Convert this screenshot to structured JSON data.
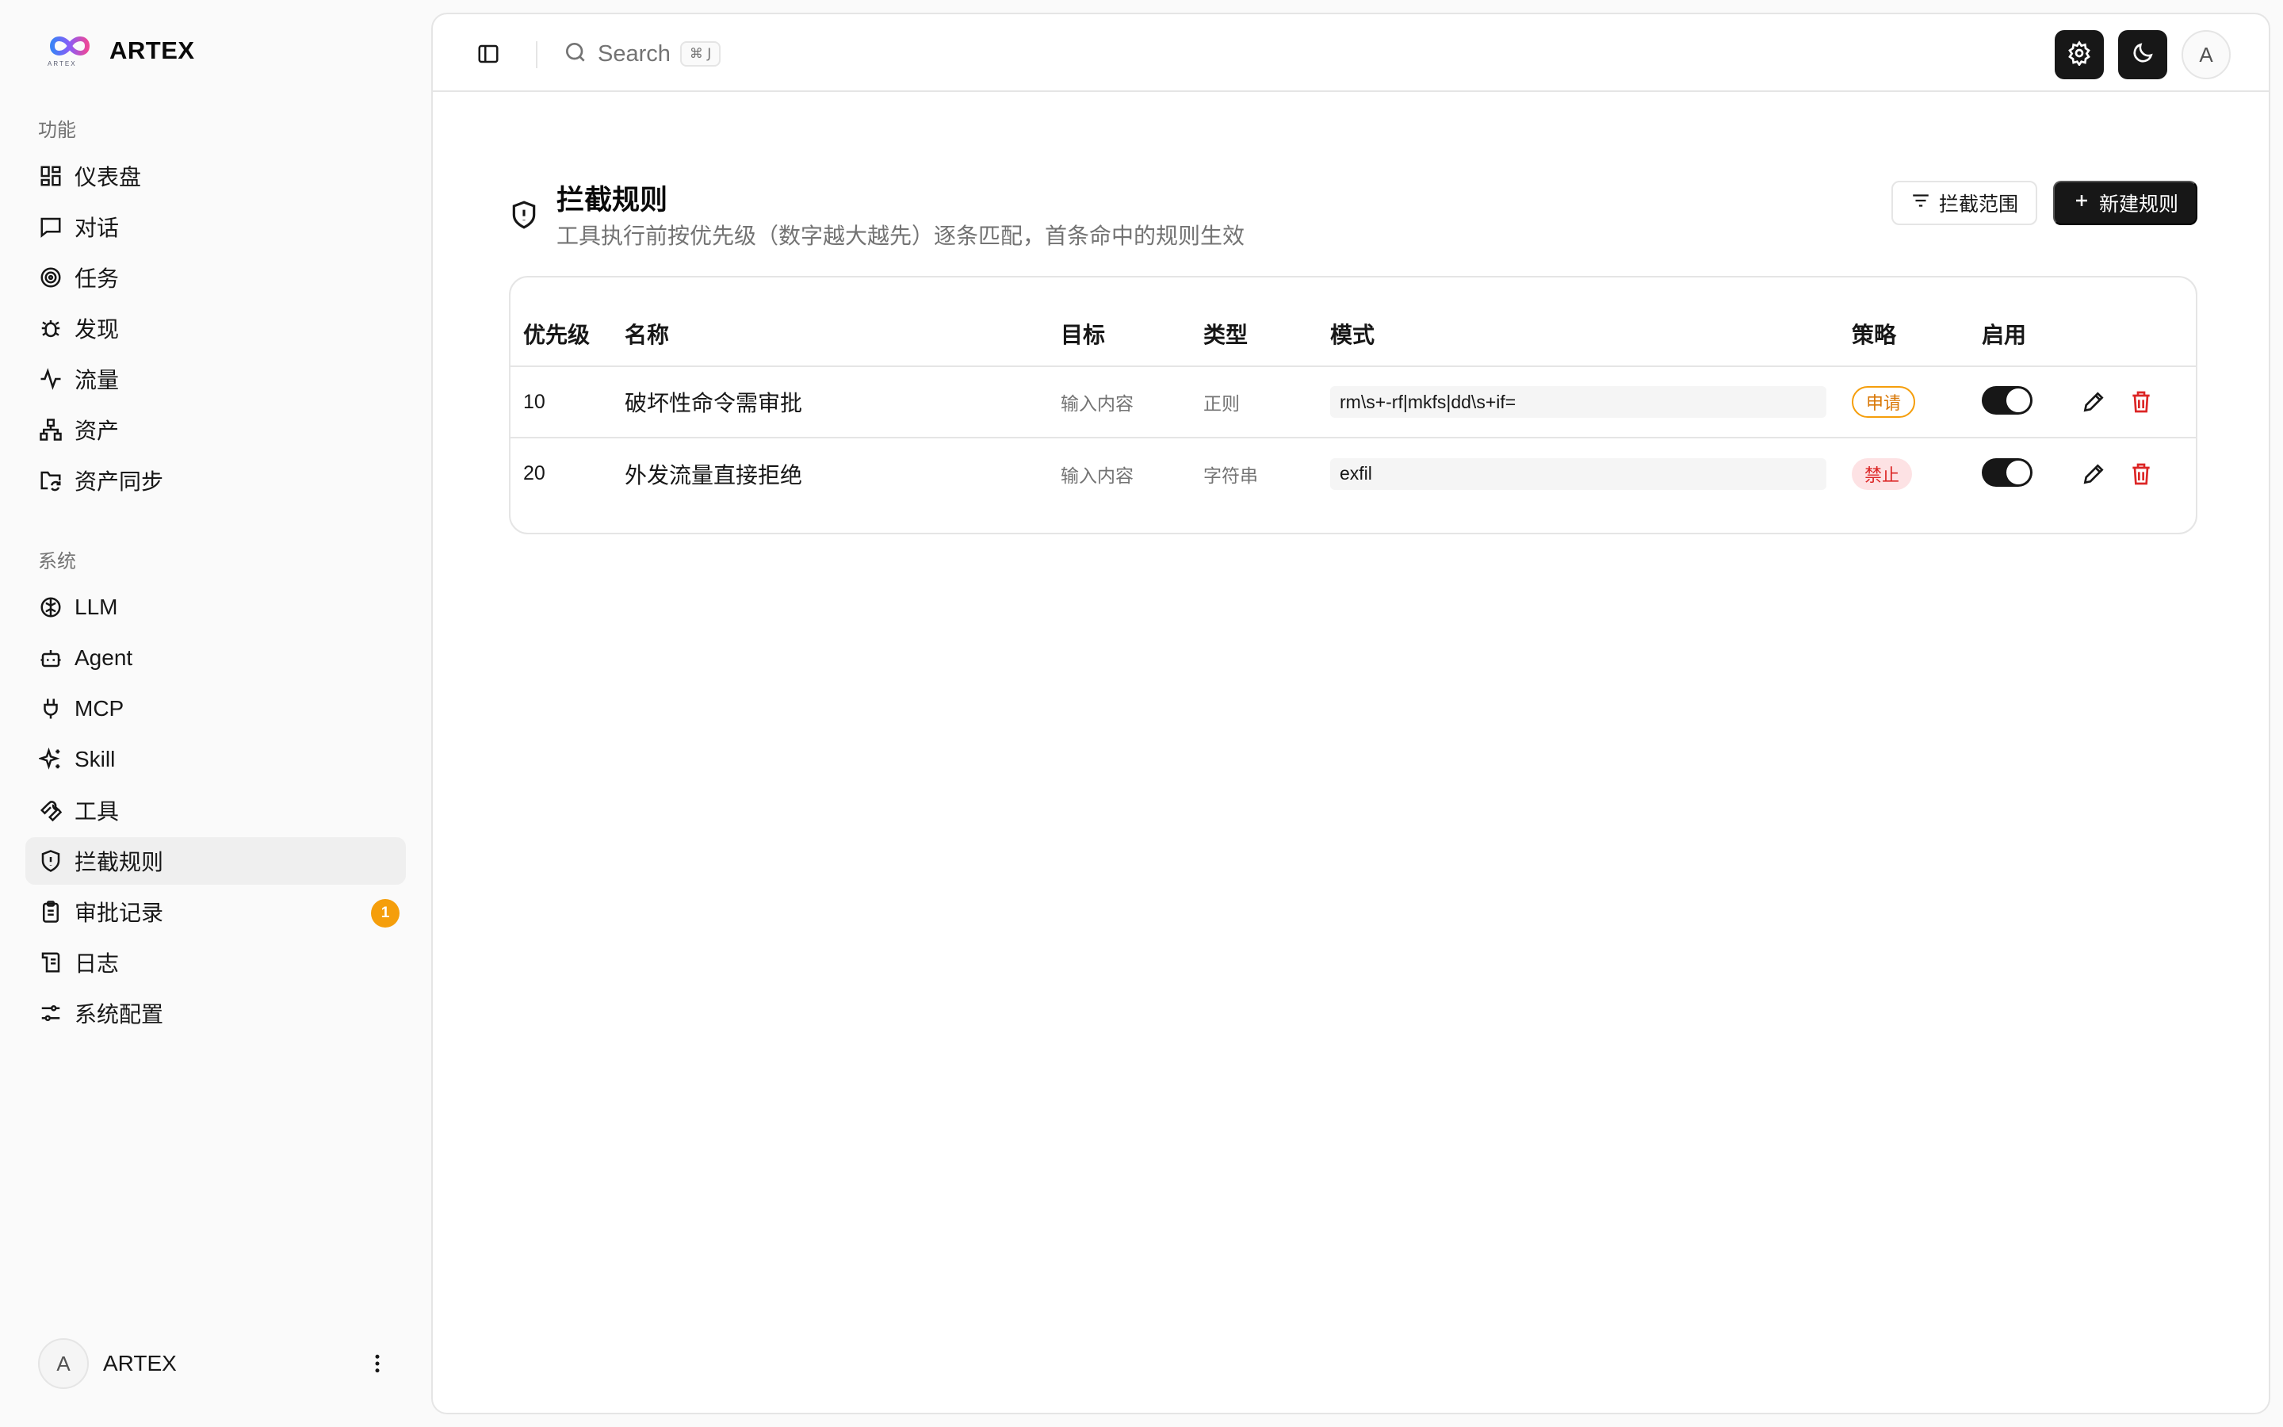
{
  "brand": {
    "name": "ARTEX",
    "logo_caption": "ARTEX"
  },
  "sidebar": {
    "groups": [
      {
        "label": "功能",
        "items": [
          {
            "label": "仪表盘",
            "icon": "dashboard-icon"
          },
          {
            "label": "对话",
            "icon": "chat-icon"
          },
          {
            "label": "任务",
            "icon": "target-icon"
          },
          {
            "label": "发现",
            "icon": "bug-icon"
          },
          {
            "label": "流量",
            "icon": "activity-icon"
          },
          {
            "label": "资产",
            "icon": "network-icon"
          },
          {
            "label": "资产同步",
            "icon": "folder-sync-icon"
          }
        ]
      },
      {
        "label": "系统",
        "items": [
          {
            "label": "LLM",
            "icon": "brain-icon"
          },
          {
            "label": "Agent",
            "icon": "bot-icon"
          },
          {
            "label": "MCP",
            "icon": "plug-icon"
          },
          {
            "label": "Skill",
            "icon": "sparkles-icon"
          },
          {
            "label": "工具",
            "icon": "wrench-icon"
          },
          {
            "label": "拦截规则",
            "icon": "shield-alert-icon",
            "active": true
          },
          {
            "label": "审批记录",
            "icon": "clipboard-icon",
            "badge": "1"
          },
          {
            "label": "日志",
            "icon": "scroll-icon"
          },
          {
            "label": "系统配置",
            "icon": "sliders-icon"
          }
        ]
      }
    ],
    "user": {
      "avatar": "A",
      "name": "ARTEX"
    }
  },
  "topbar": {
    "search_label": "Search",
    "shortcut": "⌘ J",
    "avatar": "A"
  },
  "page": {
    "title": "拦截规则",
    "subtitle": "工具执行前按优先级（数字越大越先）逐条匹配，首条命中的规则生效",
    "scope_button": "拦截范围",
    "new_button": "新建规则"
  },
  "table": {
    "headers": {
      "priority": "优先级",
      "name": "名称",
      "target": "目标",
      "type": "类型",
      "pattern": "模式",
      "strategy": "策略",
      "enabled": "启用"
    },
    "rows": [
      {
        "priority": "10",
        "name": "破坏性命令需审批",
        "target": "输入内容",
        "type": "正则",
        "pattern": "rm\\s+-rf|mkfs|dd\\s+if=",
        "strategy": "申请",
        "strategy_color": "#d97706",
        "enabled": true
      },
      {
        "priority": "20",
        "name": "外发流量直接拒绝",
        "target": "输入内容",
        "type": "字符串",
        "pattern": "exfil",
        "strategy": "禁止",
        "strategy_color": "#dc2626",
        "enabled": true
      }
    ]
  },
  "colors": {
    "accent": "#171717",
    "badge": "#f59e0b",
    "danger": "#dc2626"
  }
}
